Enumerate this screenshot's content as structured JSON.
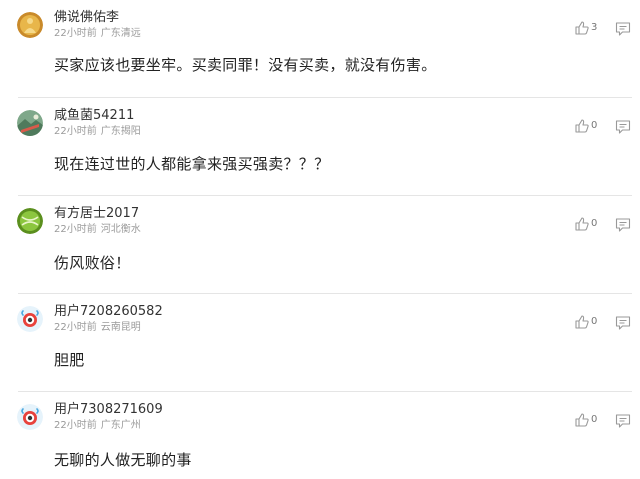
{
  "comments": [
    {
      "username": "佛说佛佑李",
      "time": "22小时前",
      "location": "广东清远",
      "text": "买家应该也要坐牢。买卖同罪！没有买卖，就没有伤害。",
      "likes": "3",
      "avatar": "buddha-avatar-icon"
    },
    {
      "username": "咸鱼菌54211",
      "time": "22小时前",
      "location": "广东揭阳",
      "text": "现在连过世的人都能拿来强买强卖？？？",
      "likes": "0",
      "avatar": "landscape-avatar-icon"
    },
    {
      "username": "有方居士2017",
      "time": "22小时前",
      "location": "河北衡水",
      "text": "伤风败俗！",
      "likes": "0",
      "avatar": "green-ball-avatar-icon"
    },
    {
      "username": "用户7208260582",
      "time": "22小时前",
      "location": "云南昆明",
      "text": "胆肥",
      "likes": "0",
      "avatar": "weibo-default-avatar-icon"
    },
    {
      "username": "用户7308271609",
      "time": "22小时前",
      "location": "广东广州",
      "text": "无聊的人做无聊的事",
      "likes": "0",
      "avatar": "weibo-default-avatar-icon"
    }
  ],
  "colors": {
    "text": "#222222",
    "meta": "#9a9a9a",
    "divider": "#e5e5e5",
    "icon": "#999999"
  }
}
